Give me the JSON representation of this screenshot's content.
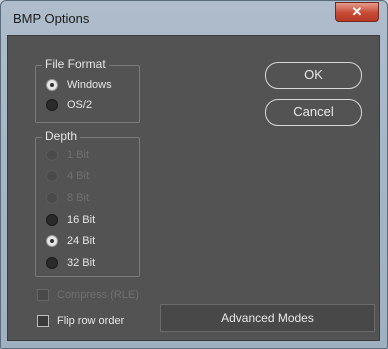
{
  "window": {
    "title": "BMP Options",
    "close_glyph": "✕"
  },
  "file_format": {
    "legend": "File Format",
    "options": [
      {
        "label": "Windows",
        "checked": true,
        "enabled": true
      },
      {
        "label": "OS/2",
        "checked": false,
        "enabled": true
      }
    ]
  },
  "depth": {
    "legend": "Depth",
    "options": [
      {
        "label": "1 Bit",
        "checked": false,
        "enabled": false
      },
      {
        "label": "4 Bit",
        "checked": false,
        "enabled": false
      },
      {
        "label": "8 Bit",
        "checked": false,
        "enabled": false
      },
      {
        "label": "16 Bit",
        "checked": false,
        "enabled": true
      },
      {
        "label": "24 Bit",
        "checked": true,
        "enabled": true
      },
      {
        "label": "32 Bit",
        "checked": false,
        "enabled": true
      }
    ]
  },
  "buttons": {
    "ok": "OK",
    "cancel": "Cancel",
    "advanced": "Advanced Modes"
  },
  "checkboxes": {
    "compress": {
      "label": "Compress (RLE)",
      "checked": false,
      "enabled": false
    },
    "flip": {
      "label": "Flip row order",
      "checked": false,
      "enabled": true
    }
  }
}
